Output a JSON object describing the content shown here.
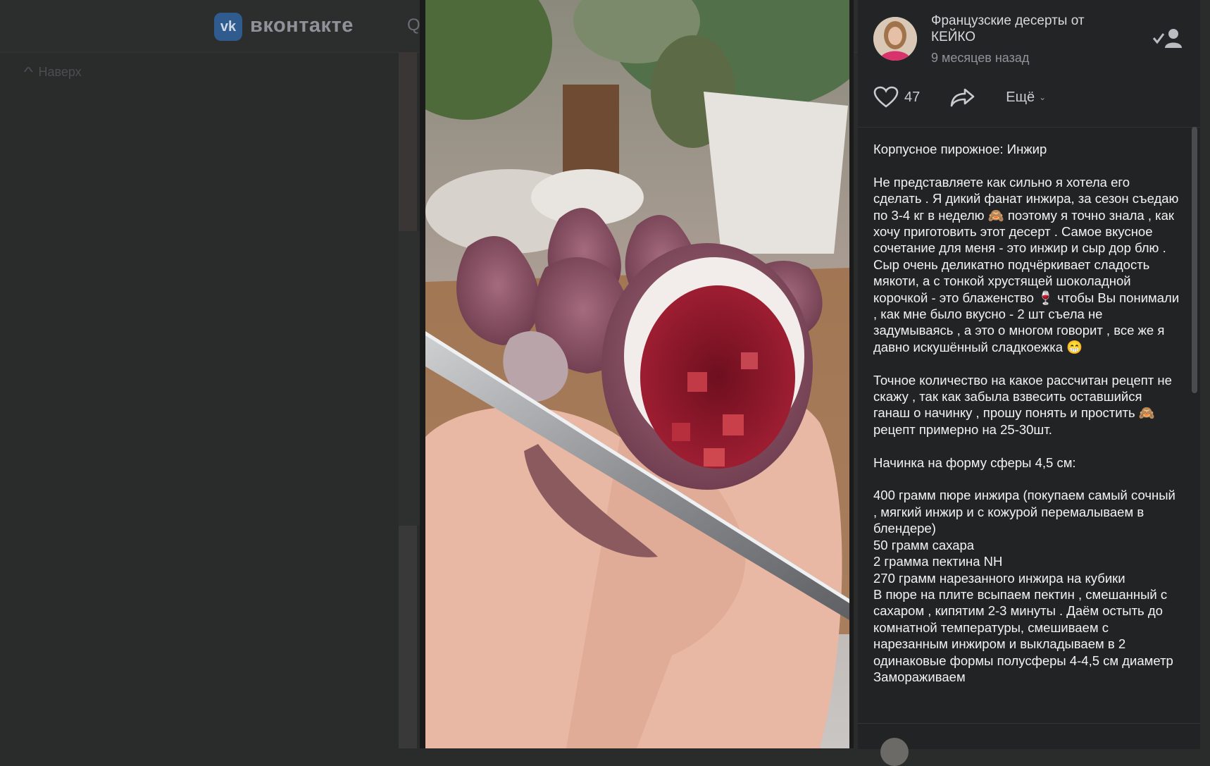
{
  "topbar": {
    "logo_text": "vk",
    "brand": "вконтакте",
    "search_glyph": "Q"
  },
  "nav": {
    "back_up_label": "Наверх"
  },
  "post": {
    "author": "Французские десерты от КЕЙКО",
    "time": "9 месяцев назад",
    "likes": "47",
    "more_label": "Ещё",
    "title": "Корпусное пирожное: Инжир",
    "paragraphs": [
      "Не представляете как сильно я хотела его сделать . Я дикий фанат инжира, за сезон съедаю по 3-4 кг в неделю 🙈 поэтому я точно знала , как хочу приготовить этот десерт . Самое вкусное сочетание для меня - это инжир и сыр дор блю . Сыр очень деликатно подчёркивает сладость мякоти, а с тонкой хрустящей шоколадной корочкой - это блаженство 🍷 чтобы Вы понимали , как мне было вкусно - 2 шт съела не задумываясь , а это о многом говорит , все же я давно искушённый сладкоежка 😁",
      "Точное количество на какое рассчитан рецепт не скажу , так как забыла взвесить оставшийся ганаш о начинку , прошу понять и простить 🙈 рецепт примерно на 25-30шт.",
      "Начинка на форму сферы 4,5 см:"
    ],
    "recipe_lines": [
      "400 грамм пюре инжира (покупаем самый сочный , мягкий инжир и с кожурой перемалываем в блендере)",
      "50 грамм сахара",
      "2 грамма пектина NH",
      "270 грамм нарезанного инжира на кубики",
      "В пюре на плите всыпаем пектин , смешанный с сахаром , кипятим 2-3 минуты . Даём остыть до комнатной температуры, смешиваем с нарезанным инжиром и выкладываем в 2 одинаковые формы полусферы 4-4,5 см диаметр",
      "Замораживаем"
    ]
  },
  "icons": {
    "like": "heart-icon",
    "share": "share-arrow-icon",
    "follow": "add-friend-icon",
    "back": "chevron-up-icon"
  },
  "colors": {
    "background": "#2a2c2c",
    "panel": "#222324",
    "text": "#f2f3f5",
    "muted": "#8f949a"
  }
}
